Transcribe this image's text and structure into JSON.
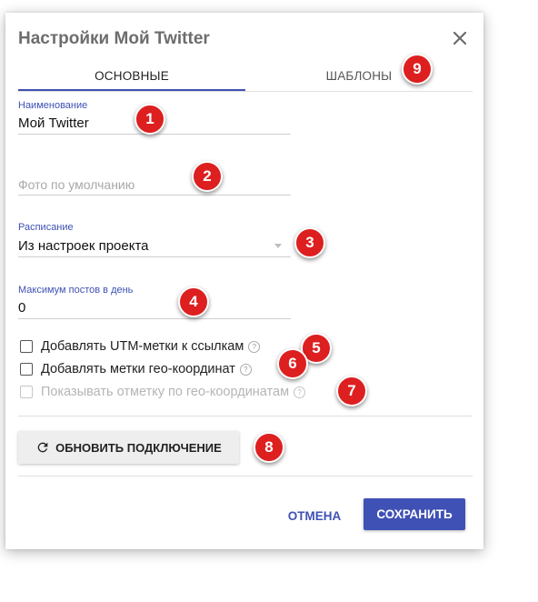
{
  "dialog": {
    "title": "Настройки Мой Twitter",
    "close_icon": "close-icon"
  },
  "tabs": [
    {
      "label": "ОСНОВНЫЕ",
      "active": true
    },
    {
      "label": "ШАБЛОНЫ",
      "active": false
    }
  ],
  "fields": {
    "name": {
      "label": "Наименование",
      "value": "Мой Twitter"
    },
    "photo": {
      "placeholder": "Фото по умолчанию"
    },
    "schedule": {
      "label": "Расписание",
      "value": "Из настроек проекта"
    },
    "max_posts": {
      "label": "Максимум постов в день",
      "value": "0"
    }
  },
  "checkboxes": [
    {
      "label": "Добавлять UTM-метки к ссылкам",
      "checked": false,
      "disabled": false
    },
    {
      "label": "Добавлять метки гео-координат",
      "checked": false,
      "disabled": false
    },
    {
      "label": "Показывать отметку по гео-координатам",
      "checked": false,
      "disabled": true
    }
  ],
  "help_glyph": "?",
  "refresh_button": {
    "label": "ОБНОВИТЬ ПОДКЛЮЧЕНИЕ",
    "icon": "refresh-icon"
  },
  "actions": {
    "cancel": "ОТМЕНА",
    "save": "СОХРАНИТЬ"
  },
  "callouts": [
    "1",
    "2",
    "3",
    "4",
    "5",
    "6",
    "7",
    "8",
    "9"
  ],
  "colors": {
    "accent": "#3f51b5",
    "callout": "#dd1f1f"
  }
}
